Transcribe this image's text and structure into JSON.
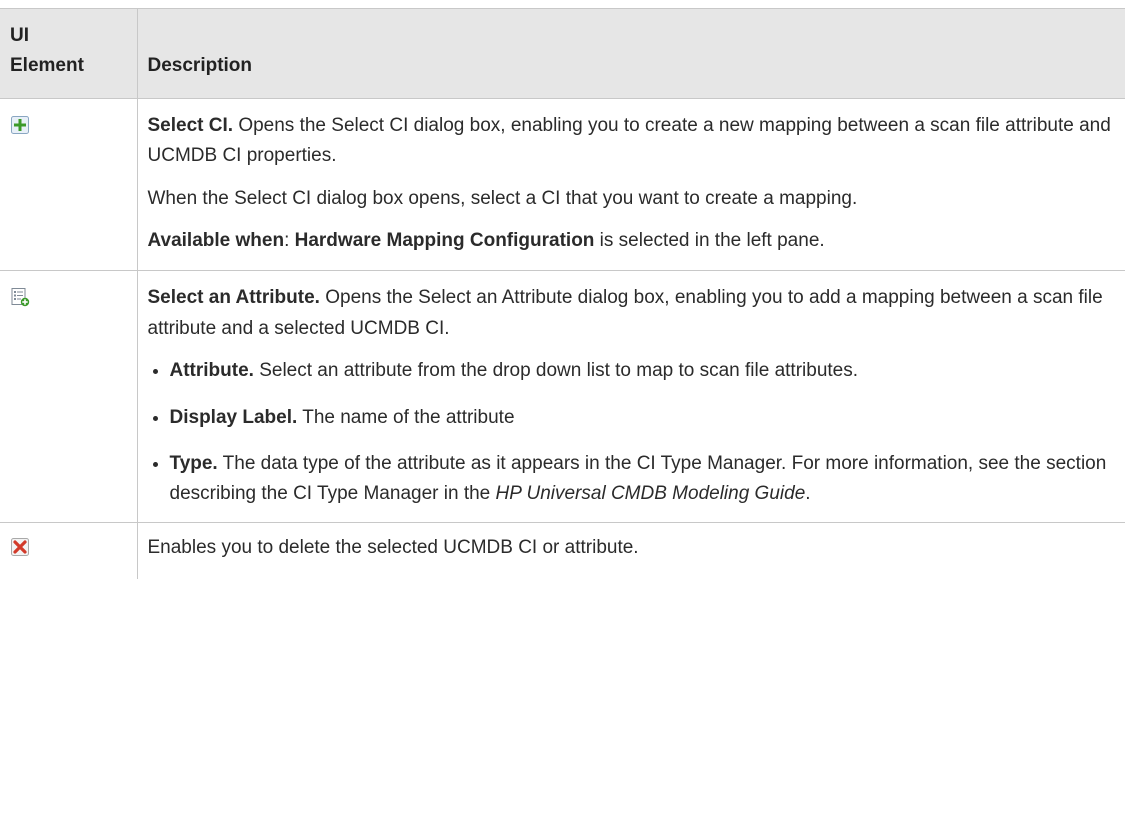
{
  "table": {
    "header_element": "UI Element",
    "header_description": "Description"
  },
  "rows": [
    {
      "icon": "add-ci-plus-icon",
      "title": "Select CI.",
      "text": " Opens the Select CI dialog box, enabling you to create a new mapping between a scan file attribute and UCMDB CI properties.",
      "note": "When the Select CI dialog box opens, select a CI that you want to create a mapping.",
      "avail_label": "Available when",
      "avail_sep": ": ",
      "avail_value": "Hardware Mapping Configuration",
      "avail_rest": " is selected in the left pane."
    },
    {
      "icon": "add-attribute-list-icon",
      "title": "Select an Attribute.",
      "text": " Opens the Select an Attribute dialog box, enabling you to add a mapping between a scan file attribute and a selected UCMDB CI.",
      "bullets": [
        {
          "term": "Attribute.",
          "desc": " Select an attribute from the drop down list to map to scan file attributes."
        },
        {
          "term": "Display Label.",
          "desc": " The name of the attribute"
        },
        {
          "term": "Type.",
          "desc": " The data type of the attribute as it appears in the CI Type Manager. For more information, see the section describing the CI Type Manager in the ",
          "ref": "HP Universal CMDB Modeling Guide",
          "end": "."
        }
      ]
    },
    {
      "icon": "delete-x-icon",
      "text": "Enables you to delete the selected UCMDB CI or attribute."
    }
  ]
}
